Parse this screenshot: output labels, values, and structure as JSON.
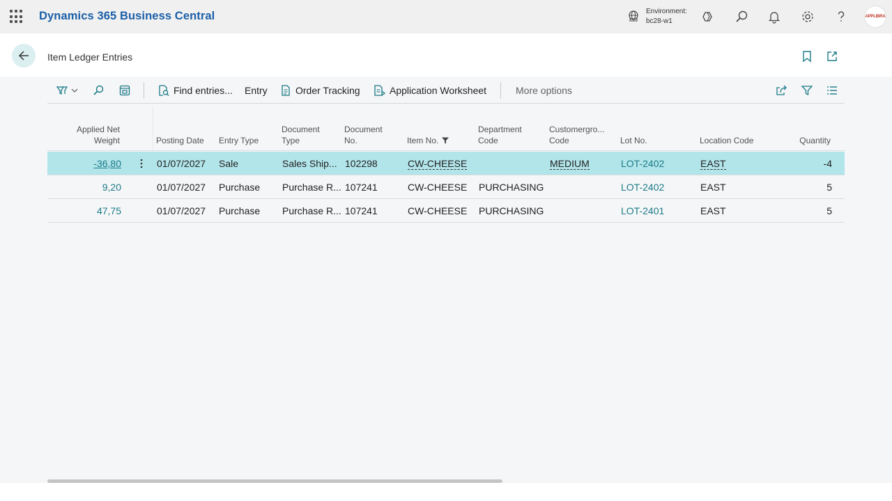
{
  "app": {
    "title": "Dynamics 365 Business Central",
    "environment_label": "Environment:",
    "environment_value": "bc28-w1",
    "avatar_text": "APPLIBRA"
  },
  "page": {
    "title": "Item Ledger Entries"
  },
  "actions": {
    "find_entries": "Find entries...",
    "entry": "Entry",
    "order_tracking": "Order Tracking",
    "application_worksheet": "Application Worksheet",
    "more_options": "More options"
  },
  "columns": {
    "applied_net_weight_1": "Applied Net",
    "applied_net_weight_2": "Weight",
    "posting_date": "Posting Date",
    "entry_type": "Entry Type",
    "document_type_1": "Document",
    "document_type_2": "Type",
    "document_no_1": "Document",
    "document_no_2": "No.",
    "item_no": "Item No.",
    "department_code_1": "Department",
    "department_code_2": "Code",
    "customergroup_code_1": "Customergro...",
    "customergroup_code_2": "Code",
    "lot_no": "Lot No.",
    "location_code": "Location Code",
    "quantity": "Quantity"
  },
  "rows": [
    {
      "applied_net_weight": "-36,80",
      "posting_date": "01/07/2027",
      "entry_type": "Sale",
      "document_type": "Sales Ship...",
      "document_no": "102298",
      "item_no": "CW-CHEESE",
      "department_code": "",
      "customergroup_code": "MEDIUM",
      "lot_no": "LOT-2402",
      "location_code": "EAST",
      "quantity": "-4"
    },
    {
      "applied_net_weight": "9,20",
      "posting_date": "01/07/2027",
      "entry_type": "Purchase",
      "document_type": "Purchase R...",
      "document_no": "107241",
      "item_no": "CW-CHEESE",
      "department_code": "PURCHASING",
      "customergroup_code": "",
      "lot_no": "LOT-2402",
      "location_code": "EAST",
      "quantity": "5"
    },
    {
      "applied_net_weight": "47,75",
      "posting_date": "01/07/2027",
      "entry_type": "Purchase",
      "document_type": "Purchase R...",
      "document_no": "107241",
      "item_no": "CW-CHEESE",
      "department_code": "PURCHASING",
      "customergroup_code": "",
      "lot_no": "LOT-2401",
      "location_code": "EAST",
      "quantity": "5"
    }
  ],
  "colors": {
    "brand": "#1b5fa8",
    "link": "#1a7a86",
    "selected_row": "#b2e5ea"
  },
  "icons": [
    "app-launcher-icon",
    "environment-icon",
    "copilot-icon",
    "search-icon",
    "bell-icon",
    "gear-icon",
    "help-icon",
    "back-arrow-icon",
    "bookmark-icon",
    "open-in-new-window-icon",
    "filter-pane-icon",
    "chevron-down-icon",
    "edit-list-icon",
    "find-entries-icon",
    "order-tracking-icon",
    "application-worksheet-icon",
    "share-icon",
    "filter-icon",
    "list-view-icon",
    "row-actions-icon"
  ]
}
